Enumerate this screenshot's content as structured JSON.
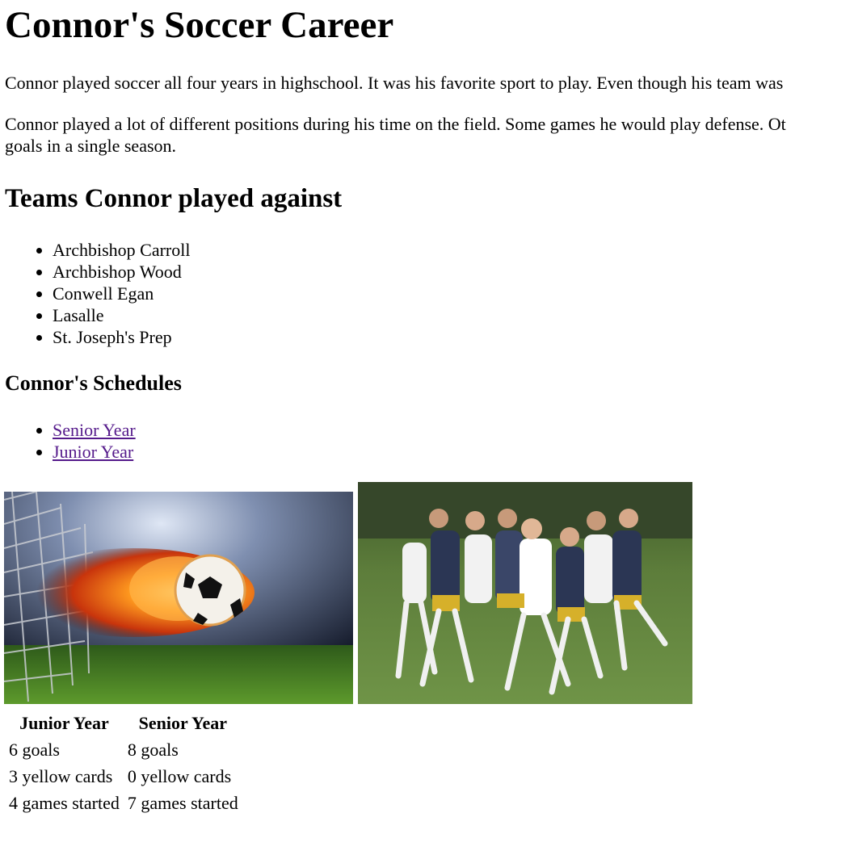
{
  "title": "Connor's Soccer Career",
  "paragraphs": [
    "Connor played soccer all four years in highschool. It was his favorite sport to play. Even though his team was",
    "Connor played a lot of different positions during his time on the field. Some games he would play defense. Other games he scored over eight goals in a single season."
  ],
  "teams_heading": "Teams Connor played against",
  "teams": [
    "Archbishop Carroll",
    "Archbishop Wood",
    "Conwell Egan",
    "Lasalle",
    "St. Joseph's Prep"
  ],
  "schedules_heading": "Connor's Schedules",
  "schedules": [
    "Senior Year",
    "Junior Year"
  ],
  "stats": {
    "headers": [
      "Junior Year",
      "Senior Year"
    ],
    "rows": [
      [
        "6 goals",
        "8 goals"
      ],
      [
        "3 yellow cards",
        "0 yellow cards"
      ],
      [
        "4 games started",
        "7 games started"
      ]
    ]
  },
  "images": {
    "fire_ball": "flaming-soccer-ball-image",
    "team_action": "soccer-players-action-photo"
  },
  "colors": {
    "link": "#551a8b",
    "text": "#000000"
  }
}
